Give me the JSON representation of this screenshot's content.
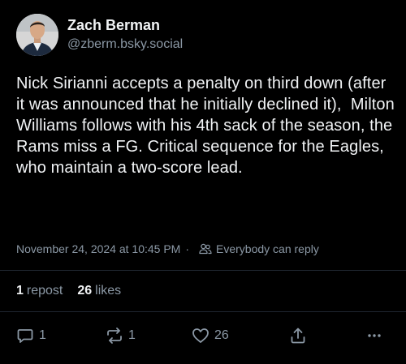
{
  "author": {
    "display_name": "Zach Berman",
    "handle": "@zberm.bsky.social"
  },
  "post": {
    "text": "Nick Sirianni accepts a penalty on third down (after it was announced that he initially declined it),  Milton Williams follows with his 4th sack of the season, the Rams miss a FG. Critical sequence for the Eagles, who maintain a two-score lead."
  },
  "meta": {
    "timestamp": "November 24, 2024 at 10:45 PM",
    "separator": "·",
    "reply_setting": "Everybody can reply"
  },
  "stats": {
    "reposts_count": "1",
    "reposts_label": "repost",
    "likes_count": "26",
    "likes_label": "likes"
  },
  "actions": {
    "reply_count": "1",
    "repost_count": "1",
    "like_count": "26"
  },
  "icons": [
    "reply-icon",
    "repost-icon",
    "like-icon",
    "share-icon",
    "more-icon",
    "people-icon"
  ],
  "colors": {
    "background": "#000000",
    "text": "#f1f3f5",
    "muted": "#8b98a5",
    "divider": "#1f2630"
  }
}
